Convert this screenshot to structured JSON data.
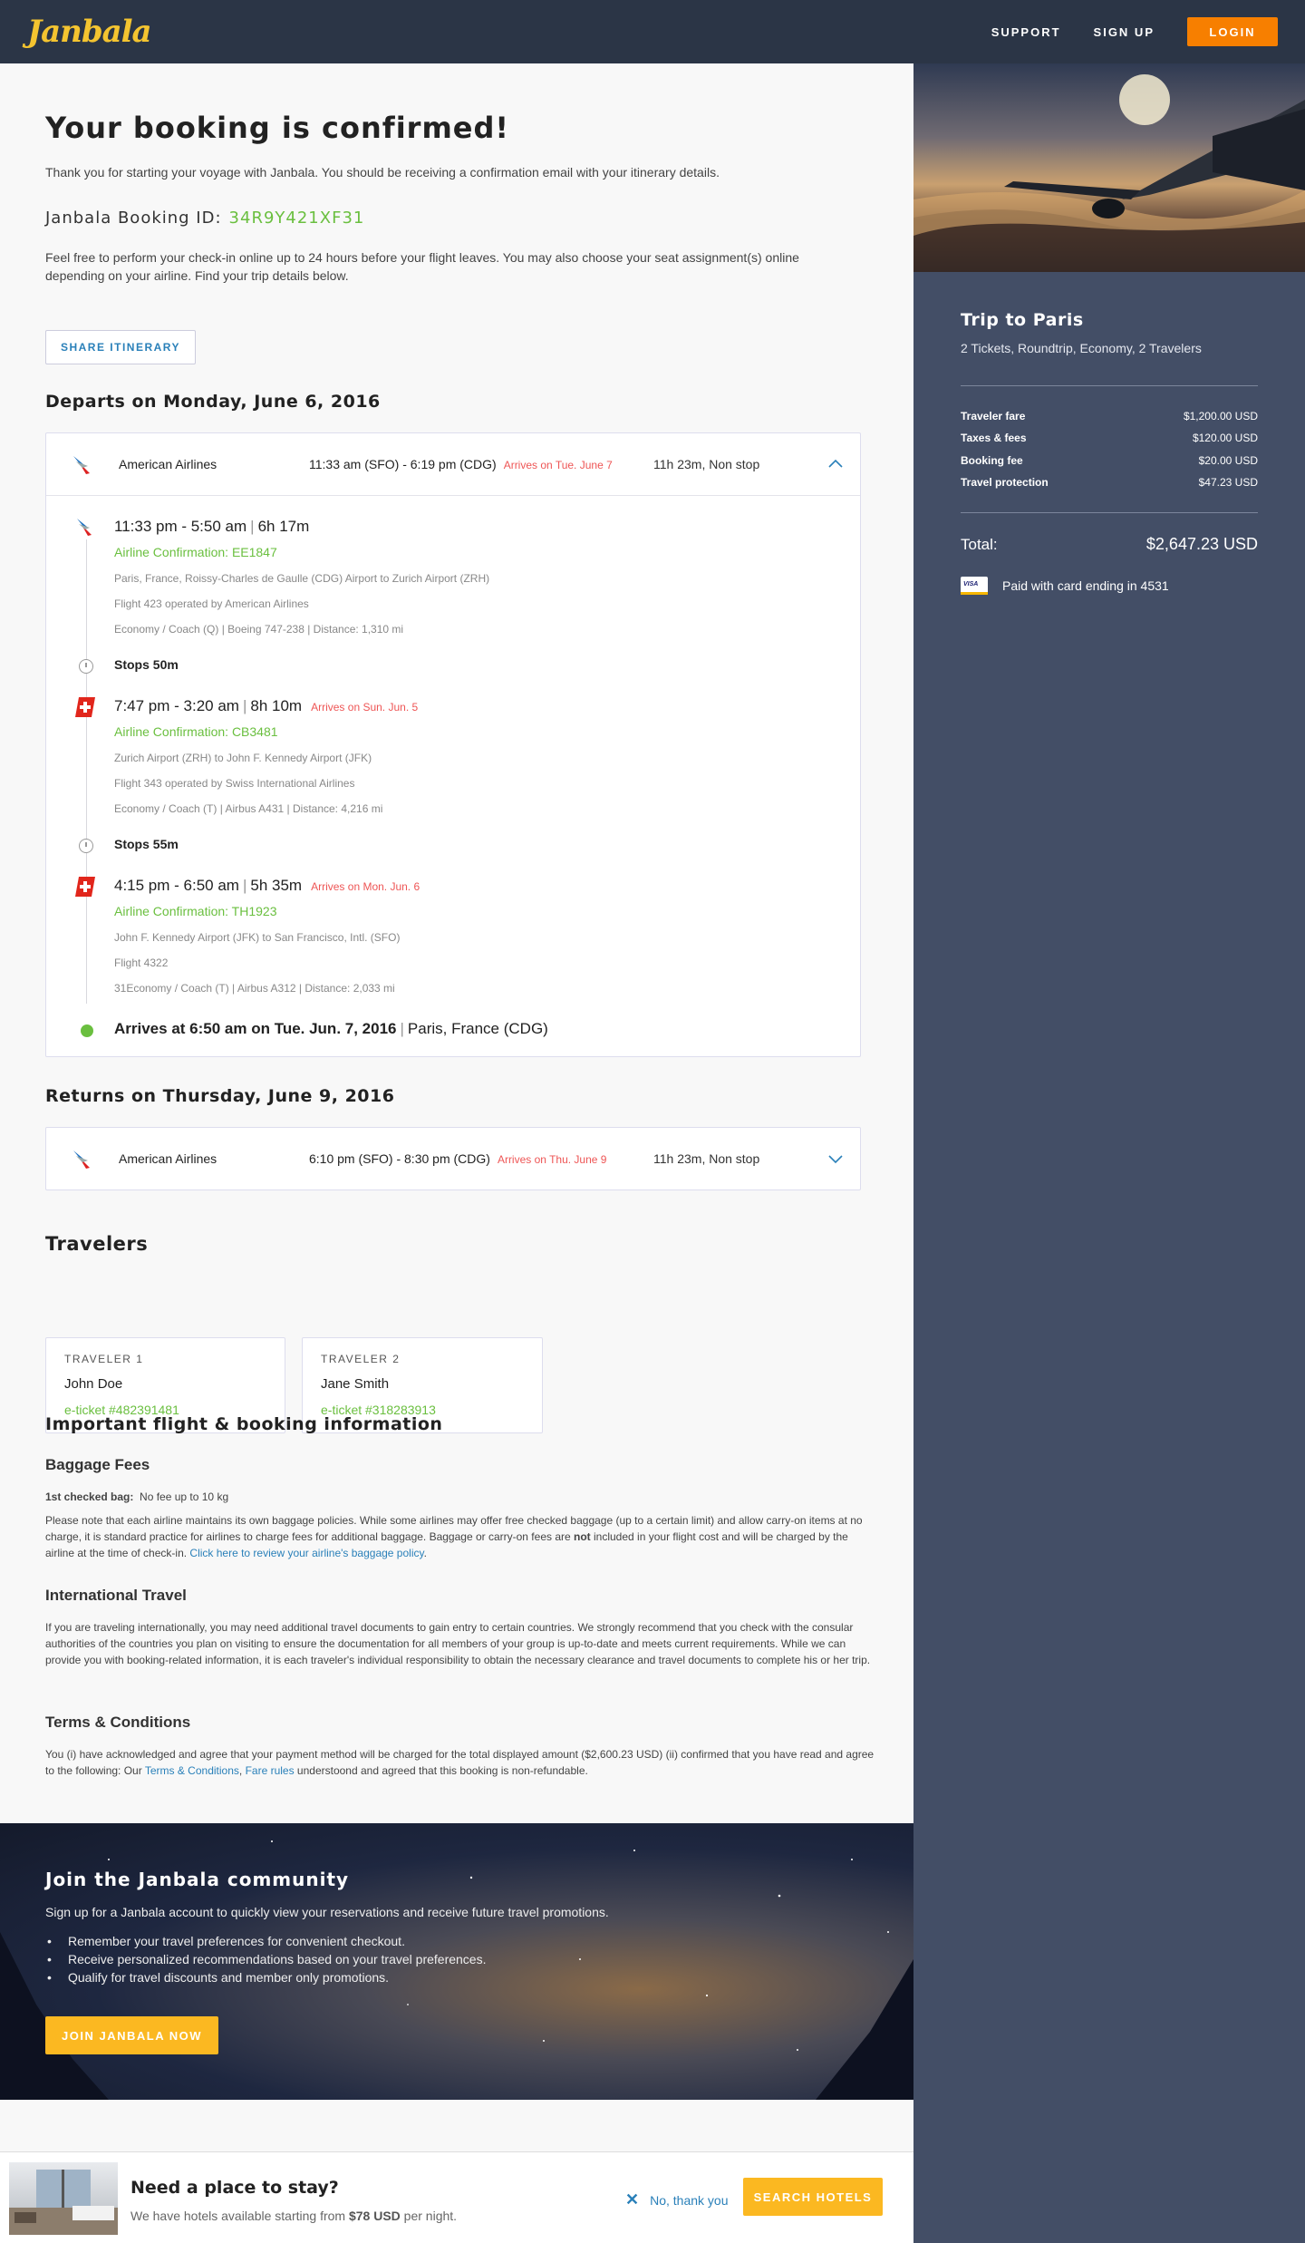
{
  "header": {
    "logo": "Janbala",
    "nav": [
      "SUPPORT",
      "SIGN UP"
    ],
    "login_label": "LOGIN"
  },
  "confirmation": {
    "title": "Your booking is confirmed!",
    "lead": "Thank you for starting your voyage with Janbala. You should be receiving a confirmation email with your itinerary details.",
    "booking_id_label": "Janbala Booking ID:",
    "booking_id": "34R9Y421XF31",
    "checkin_text": "Feel free to perform your check-in online up to 24 hours before your flight leaves. You may also choose your seat assignment(s) online depending on your airline. Find your trip details below.",
    "share_label": "SHARE ITINERARY"
  },
  "departure": {
    "heading": "Departs on Monday, June 6, 2016",
    "airline": "American Airlines",
    "times": "11:33 am (SFO) - 6:19 pm (CDG)",
    "arrives": "Arrives on Tue. June 7",
    "duration": "11h 23m, Non stop",
    "segments": [
      {
        "time": "11:33 pm - 5:50 am",
        "dur": "6h 17m",
        "arrives": "",
        "conf": "Airline Confirmation: EE1847",
        "route": "Paris, France, Roissy-Charles de Gaulle (CDG) Airport  to Zurich Airport (ZRH)",
        "flight": "Flight 423 operated by American Airlines",
        "cabin": "Economy / Coach (Q) | Boeing 747-238 | Distance: 1,310 mi",
        "logo": "american-airlines"
      },
      {
        "time": "7:47 pm - 3:20 am",
        "dur": "8h 10m",
        "arrives": "Arrives on Sun. Jun. 5",
        "conf": "Airline Confirmation: CB3481",
        "route": "Zurich Airport (ZRH) to John F. Kennedy Airport (JFK)",
        "flight": "Flight 343 operated by Swiss International Airlines",
        "cabin": "Economy / Coach (T) | Airbus A431 | Distance: 4,216 mi",
        "logo": "swiss"
      },
      {
        "time": "4:15 pm - 6:50 am",
        "dur": "5h 35m",
        "arrives": "Arrives on Mon. Jun. 6",
        "conf": "Airline Confirmation: TH1923",
        "route": "John F. Kennedy Airport (JFK) to San Francisco, Intl. (SFO)",
        "flight": "Flight 4322",
        "cabin": "31Economy / Coach (T) | Airbus A312 | Distance: 2,033 mi",
        "logo": "swiss"
      }
    ],
    "stops": [
      "Stops 50m",
      "Stops 55m"
    ],
    "arrival_bold": "Arrives at 6:50 am on Tue. Jun. 7, 2016",
    "arrival_place": "Paris, France (CDG)"
  },
  "return": {
    "heading": "Returns on Thursday, June 9, 2016",
    "airline": "American Airlines",
    "times": "6:10 pm (SFO) - 8:30 pm (CDG)",
    "arrives": "Arrives on Thu. June 9",
    "duration": "11h 23m, Non stop"
  },
  "travelers": {
    "heading": "Travelers",
    "items": [
      {
        "label": "TRAVELER 1",
        "name": "John Doe",
        "ticket": "e-ticket #482391481"
      },
      {
        "label": "TRAVELER 2",
        "name": "Jane Smith",
        "ticket": "e-ticket #318283913"
      }
    ]
  },
  "info": {
    "heading": "Important flight & booking information",
    "baggage_heading": "Baggage Fees",
    "baggage_key": "1st checked bag:",
    "baggage_val": "No fee up to 10 kg",
    "baggage_p1": "Please note that each airline maintains its own baggage policies. While some airlines may offer free checked baggage (up to a certain limit) and allow carry-on items at no charge, it is standard practice for airlines to charge fees for additional baggage. Baggage or carry-on fees are ",
    "baggage_not": "not",
    "baggage_p2": " included in your flight cost and will be charged by the airline at the time of check-in. ",
    "baggage_link": "Click here to review your airline's baggage policy",
    "intl_heading": "International Travel",
    "intl_text": "If you are traveling internationally, you may need additional travel documents to gain entry to certain countries. We strongly recommend that you check with the consular authorities of the countries you plan on visiting to ensure the documentation for all members of your group is up-to-date and meets current requirements. While we can provide you with booking-related information, it is each traveler's individual responsibility to obtain the necessary clearance and travel documents to complete his or her trip.",
    "terms_heading": "Terms & Conditions",
    "terms_p1": "You (i) have acknowledged and agree that your payment method will be charged for the total displayed amount ($2,600.23 USD) (ii) confirmed that you have read and agree to the following: Our ",
    "terms_link1": "Terms & Conditions",
    "terms_comma": ", ",
    "terms_link2": "Fare rules",
    "terms_p2": " understoond and agreed that this booking is non-refundable."
  },
  "community": {
    "title": "Join the Janbala community",
    "lead": "Sign up for a Janbala account to quickly view your reservations and receive future travel promotions.",
    "bullets": [
      "Remember your travel preferences for convenient checkout.",
      "Receive personalized recommendations based on your travel preferences.",
      "Qualify for travel discounts and member only promotions."
    ],
    "button": "JOIN JANBALA NOW"
  },
  "sidebar": {
    "title": "Trip to Paris",
    "subtitle": "2 Tickets, Roundtrip, Economy, 2 Travelers",
    "fees": [
      {
        "k": "Traveler fare",
        "v": "$1,200.00 USD"
      },
      {
        "k": "Taxes & fees",
        "v": "$120.00 USD"
      },
      {
        "k": "Booking fee",
        "v": "$20.00 USD"
      },
      {
        "k": "Travel protection",
        "v": "$47.23 USD"
      }
    ],
    "total_label": "Total:",
    "total_value": "$2,647.23 USD",
    "visa_text": "VISA",
    "paid_text": "Paid with card ending in 4531"
  },
  "hotel": {
    "title": "Need a place to stay?",
    "sub_pre": "We have hotels available starting from ",
    "sub_price": "$78 USD",
    "sub_post": " per night.",
    "no_thanks": "No, thank you",
    "no_thanks_icon": "✕",
    "button": "SEARCH HOTELS"
  },
  "colors": {
    "accent_green": "#6abf3f",
    "accent_orange": "#f77f00",
    "accent_yellow": "#fbb821",
    "link_blue": "#2a80b9",
    "arrive_red": "#e55555",
    "sidebar_bg": "#434e66",
    "header_bg": "#2b3546"
  }
}
